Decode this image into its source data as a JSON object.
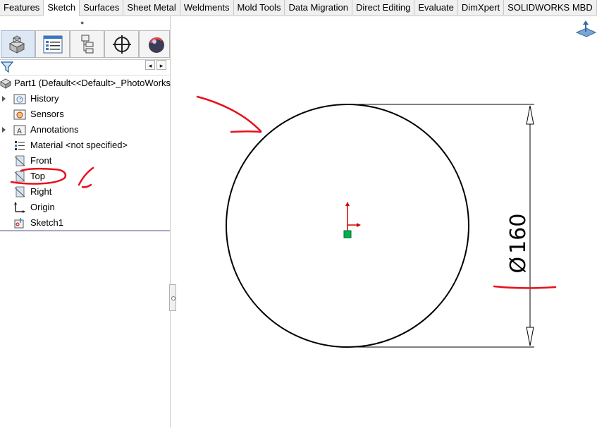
{
  "command_tabs": [
    "Features",
    "Sketch",
    "Surfaces",
    "Sheet Metal",
    "Weldments",
    "Mold Tools",
    "Data Migration",
    "Direct Editing",
    "Evaluate",
    "DimXpert",
    "SOLIDWORKS MBD"
  ],
  "active_tab": "Sketch",
  "feature_tree": {
    "root": "Part1  (Default<<Default>_PhotoWorks",
    "items": [
      {
        "label": "History",
        "icon": "history-folder-icon"
      },
      {
        "label": "Sensors",
        "icon": "sensors-folder-icon"
      },
      {
        "label": "Annotations",
        "icon": "annotations-folder-icon"
      },
      {
        "label": "Material <not specified>",
        "icon": "material-icon"
      },
      {
        "label": "Front",
        "icon": "plane-icon"
      },
      {
        "label": "Top",
        "icon": "plane-icon"
      },
      {
        "label": "Right",
        "icon": "plane-icon"
      },
      {
        "label": "Origin",
        "icon": "origin-icon"
      },
      {
        "label": "Sketch1",
        "icon": "sketch-icon"
      }
    ]
  },
  "dimension": {
    "symbol": "Ø",
    "value": "160"
  },
  "colors": {
    "annotation": "#e8101c",
    "accent": "#3a78c3",
    "origin": "#d40000",
    "origin_point": "#00b050"
  }
}
